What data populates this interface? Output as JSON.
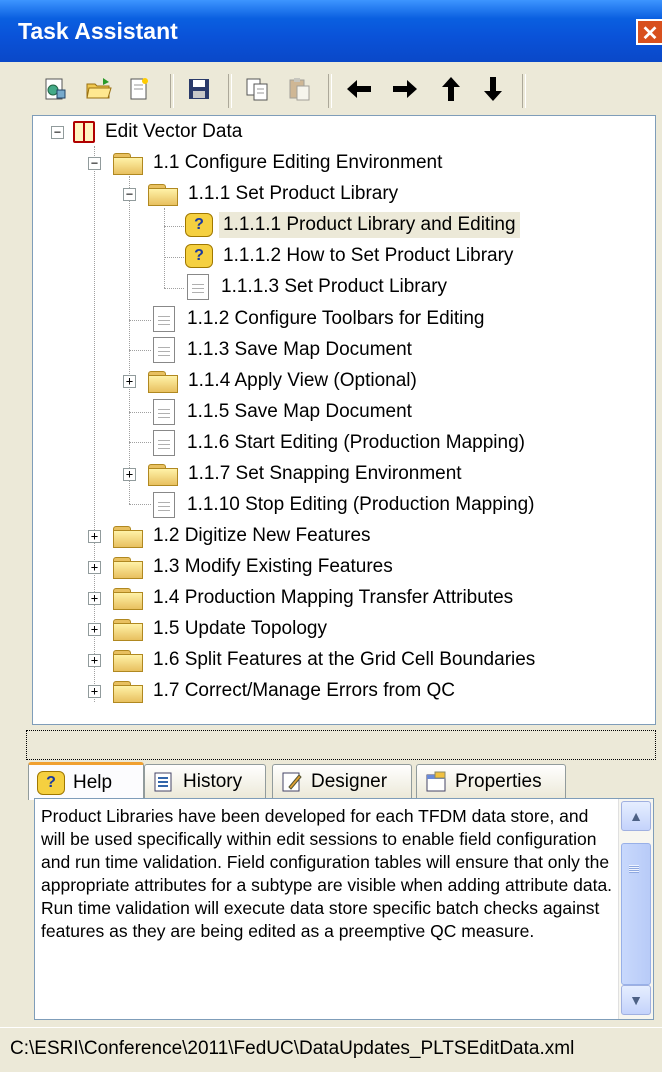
{
  "window": {
    "title": "Task Assistant",
    "close_icon": "close-icon"
  },
  "toolbar": {
    "buttons": [
      {
        "icon": "new-workflow-icon"
      },
      {
        "icon": "open-folder-icon"
      },
      {
        "icon": "new-page-icon"
      },
      {
        "icon": "save-icon"
      },
      {
        "icon": "copy-icon"
      },
      {
        "icon": "paste-icon"
      },
      {
        "icon": "arrow-left-icon",
        "glyph": "🡐"
      },
      {
        "icon": "arrow-right-icon",
        "glyph": "🡒"
      },
      {
        "icon": "arrow-up-icon",
        "glyph": "🡑"
      },
      {
        "icon": "arrow-down-icon",
        "glyph": "🡓"
      }
    ]
  },
  "tree": {
    "root": "Edit Vector Data",
    "items": [
      {
        "label": "1.1 Configure Editing Environment",
        "icon": "folder-open-icon"
      },
      {
        "label": "1.1.1 Set Product Library",
        "icon": "folder-open-icon"
      },
      {
        "label": "1.1.1.1 Product Library and Editing",
        "icon": "help-icon",
        "selected": true
      },
      {
        "label": "1.1.1.2 How to Set Product Library",
        "icon": "help-icon"
      },
      {
        "label": "1.1.1.3 Set Product Library",
        "icon": "page-icon"
      },
      {
        "label": "1.1.2 Configure Toolbars for Editing",
        "icon": "page-icon"
      },
      {
        "label": "1.1.3 Save Map Document",
        "icon": "page-icon"
      },
      {
        "label": "1.1.4 Apply View (Optional)",
        "icon": "folder-icon"
      },
      {
        "label": "1.1.5 Save Map Document",
        "icon": "page-icon"
      },
      {
        "label": "1.1.6 Start Editing (Production Mapping)",
        "icon": "page-icon"
      },
      {
        "label": "1.1.7 Set Snapping Environment",
        "icon": "folder-icon"
      },
      {
        "label": "1.1.10 Stop Editing (Production Mapping)",
        "icon": "page-icon"
      },
      {
        "label": "1.2 Digitize New Features",
        "icon": "folder-icon"
      },
      {
        "label": "1.3 Modify Existing Features",
        "icon": "folder-icon"
      },
      {
        "label": "1.4 Production Mapping Transfer Attributes",
        "icon": "folder-icon"
      },
      {
        "label": "1.5 Update Topology",
        "icon": "folder-icon"
      },
      {
        "label": "1.6 Split Features at the Grid Cell Boundaries",
        "icon": "folder-icon"
      },
      {
        "label": "1.7 Correct/Manage Errors from QC",
        "icon": "folder-icon"
      }
    ]
  },
  "tabs": [
    {
      "label": "Help",
      "icon": "help-icon",
      "active": true
    },
    {
      "label": "History",
      "icon": "history-icon"
    },
    {
      "label": "Designer",
      "icon": "designer-icon"
    },
    {
      "label": "Properties",
      "icon": "properties-icon"
    }
  ],
  "help_text": "Product Libraries have been developed for each TFDM data store, and will be used specifically  within edit sessions to enable field configuration and run time validation.  Field configuration tables will ensure that only the appropriate attributes for a subtype are visible when adding attribute data. Run time validation will execute data store specific batch checks against features as they are being edited as a preemptive QC measure.",
  "status_path": "C:\\ESRI\\Conference\\2011\\FedUC\\DataUpdates_PLTSEditData.xml"
}
